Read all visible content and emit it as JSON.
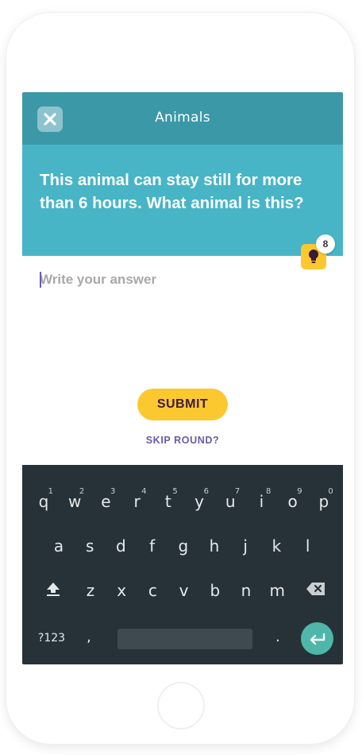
{
  "header": {
    "title": "Animals"
  },
  "question": {
    "text": "This animal can stay still for more than 6 hours. What animal is this?"
  },
  "hint": {
    "count": "8",
    "icon": "lightbulb-icon"
  },
  "answer": {
    "placeholder": "Write your answer",
    "value": ""
  },
  "actions": {
    "submit_label": "SUBMIT",
    "skip_label": "SKIP ROUND?"
  },
  "keyboard": {
    "row1": [
      {
        "key": "q",
        "num": "1"
      },
      {
        "key": "w",
        "num": "2"
      },
      {
        "key": "e",
        "num": "3"
      },
      {
        "key": "r",
        "num": "4"
      },
      {
        "key": "t",
        "num": "5"
      },
      {
        "key": "y",
        "num": "6"
      },
      {
        "key": "u",
        "num": "7"
      },
      {
        "key": "i",
        "num": "8"
      },
      {
        "key": "o",
        "num": "9"
      },
      {
        "key": "p",
        "num": "0"
      }
    ],
    "row2": [
      "a",
      "s",
      "d",
      "f",
      "g",
      "h",
      "j",
      "k",
      "l"
    ],
    "row3": [
      "z",
      "x",
      "c",
      "v",
      "b",
      "n",
      "m"
    ],
    "symbols_label": "?123",
    "comma_label": ",",
    "period_label": "."
  },
  "colors": {
    "header_bg": "#3b98a7",
    "question_bg": "#47b5c6",
    "accent_yellow": "#fbc830",
    "skip_purple": "#6b5aa8",
    "keyboard_bg": "#263238",
    "enter_teal": "#4fb6aa"
  }
}
